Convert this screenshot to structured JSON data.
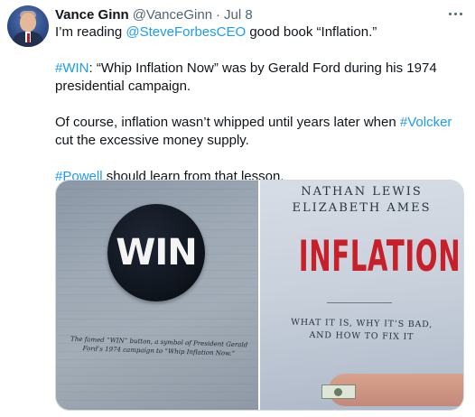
{
  "author": {
    "display_name": "Vance Ginn",
    "handle": "@VanceGinn",
    "separator": "·",
    "date": "Jul 8"
  },
  "tweet": {
    "p1_prefix": "I’m reading ",
    "p1_mention": "@SteveForbesCEO",
    "p1_suffix": " good book “Inflation.”",
    "p2_hashtag": "#WIN",
    "p2_text": ": “Whip Inflation Now” was by Gerald Ford during his 1974 presidential campaign.",
    "p3_prefix": "Of course, inflation wasn’t whipped until years later when ",
    "p3_hashtag": "#Volcker",
    "p3_suffix": " cut the excessive money supply.",
    "p4_hashtag": "#Powell",
    "p4_suffix": " should learn from that lesson."
  },
  "media": {
    "left": {
      "button_text": "WIN",
      "caption": "The famed “WIN” button, a symbol of President Gerald Ford’s 1974 campaign to “Whip Inflation Now.”"
    },
    "right": {
      "author_1": "NATHAN LEWIS",
      "author_2": "ELIZABETH AMES",
      "title": "INFLATION",
      "subtitle_1": "WHAT IT IS, WHY IT’S BAD,",
      "subtitle_2": "AND HOW TO FIX IT"
    }
  },
  "colors": {
    "link": "#1d9bf0",
    "text": "#0f1419",
    "secondary": "#536471",
    "book_title": "#c8202a"
  },
  "icons": {
    "more": "more-icon"
  }
}
